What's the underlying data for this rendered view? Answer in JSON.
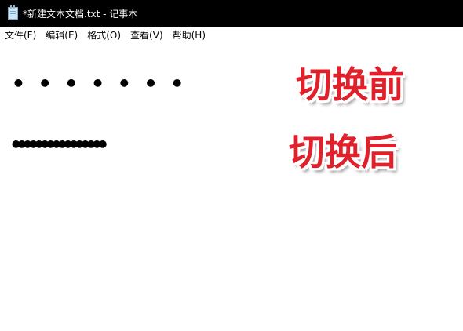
{
  "window": {
    "title": "*新建文本文档.txt - 记事本",
    "icon": "notepad-icon"
  },
  "menu": {
    "items": [
      {
        "label": "文件(F)"
      },
      {
        "label": "编辑(E)"
      },
      {
        "label": "格式(O)"
      },
      {
        "label": "查看(V)"
      },
      {
        "label": "帮助(H)"
      }
    ]
  },
  "editor": {
    "line_before": "• • • • • • •",
    "line_after": "••••••••••••••••"
  },
  "annotations": {
    "before_label": "切换前",
    "after_label": "切换后",
    "color": "#e0202a"
  }
}
